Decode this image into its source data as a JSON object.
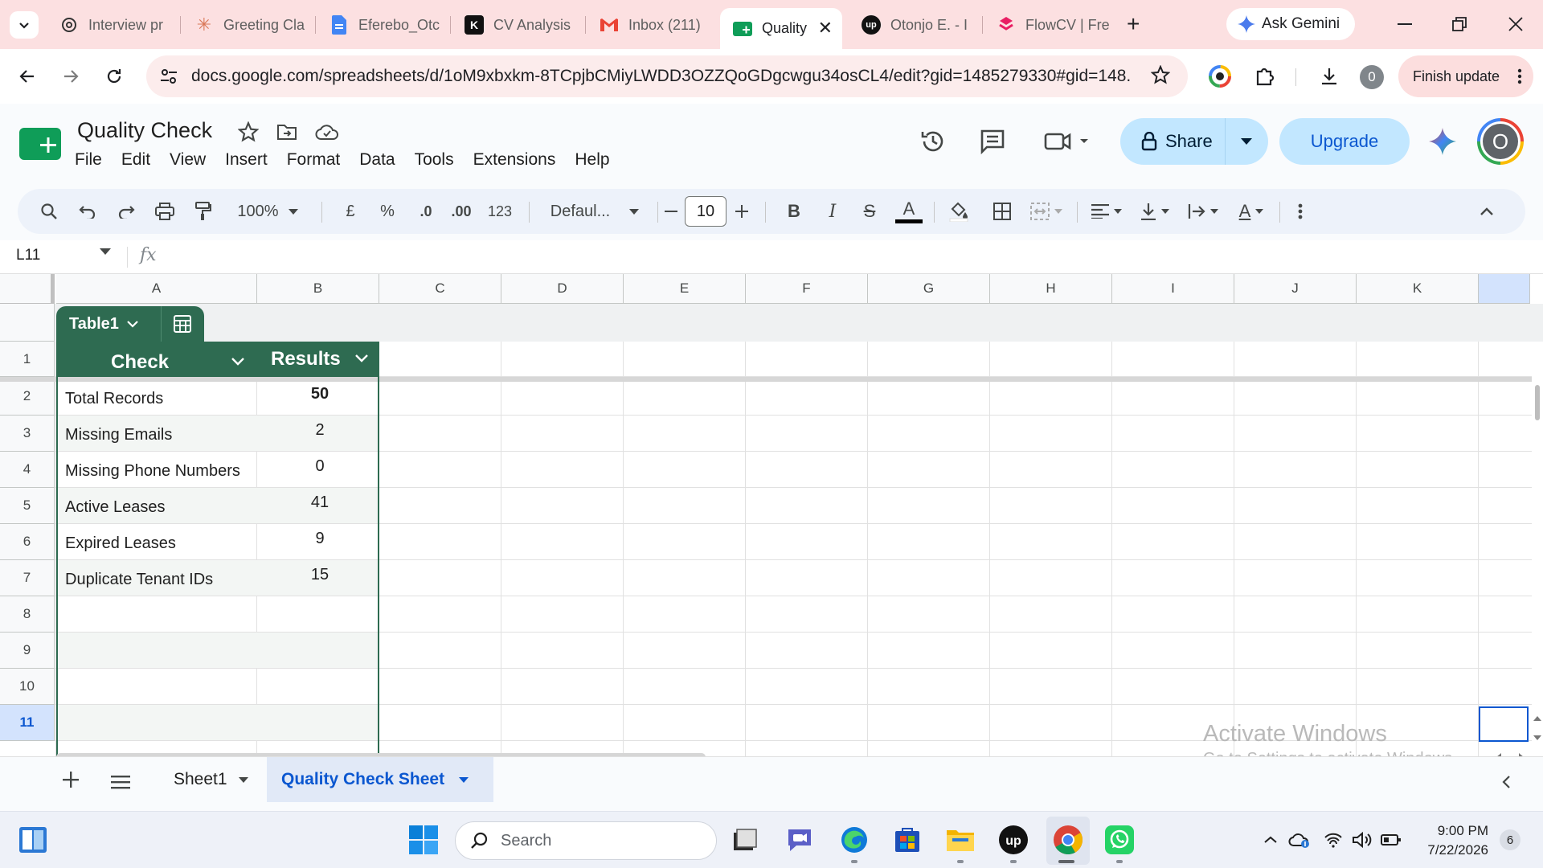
{
  "browser": {
    "tabs": [
      {
        "label": "Interview pr",
        "icon": "openai-icon"
      },
      {
        "label": "Greeting Cla",
        "icon": "claude-icon"
      },
      {
        "label": "Eferebo_Otc",
        "icon": "google-docs-icon"
      },
      {
        "label": "CV Analysis",
        "icon": "k-logo-icon"
      },
      {
        "label": "Inbox (211)",
        "icon": "gmail-icon"
      },
      {
        "label": "Quality",
        "icon": "google-sheets-icon",
        "active": true
      },
      {
        "label": "Otonjo E. - I",
        "icon": "upwork-icon"
      },
      {
        "label": "FlowCV | Fre",
        "icon": "flowcv-icon"
      }
    ],
    "ask_gemini": "Ask Gemini",
    "url": "docs.google.com/spreadsheets/d/1oM9xbxkm-8TCpjbCMiyLWDD3OZZQoGDgcwgu34osCL4/edit?gid=1485279330#gid=148...",
    "profile_initial": "0",
    "finish_update": "Finish update"
  },
  "sheets": {
    "title": "Quality Check",
    "menu": [
      "File",
      "Edit",
      "View",
      "Insert",
      "Format",
      "Data",
      "Tools",
      "Extensions",
      "Help"
    ],
    "share_label": "Share",
    "upgrade_label": "Upgrade",
    "avatar_initial": "O",
    "accent": "#2e6b51",
    "toolbar": {
      "zoom": "100%",
      "currency": "£",
      "percent": "%",
      "dec_decrease": ".0",
      "dec_increase": ".00",
      "number_format": "123",
      "font": "Defaul...",
      "font_size": "10",
      "bold": "B",
      "italic": "I",
      "strike": "S",
      "text_color": "A",
      "text_rotate": "A"
    },
    "name_box": "L11",
    "fx": "fx",
    "columns": [
      "A",
      "B",
      "C",
      "D",
      "E",
      "F",
      "G",
      "H",
      "I",
      "J",
      "K"
    ],
    "rows": [
      "1",
      "2",
      "3",
      "4",
      "5",
      "6",
      "7",
      "8",
      "9",
      "10",
      "11"
    ],
    "table": {
      "name": "Table1",
      "headers": [
        "Check",
        "Results"
      ],
      "rows": [
        {
          "check": "Total Records",
          "result": "50"
        },
        {
          "check": "Missing Emails",
          "result": "2"
        },
        {
          "check": "Missing Phone Numbers",
          "result": "0"
        },
        {
          "check": "Active Leases",
          "result": "41"
        },
        {
          "check": "Expired Leases",
          "result": "9"
        },
        {
          "check": "Duplicate Tenant IDs",
          "result": "15"
        }
      ]
    },
    "watermark": {
      "line1": "Activate Windows",
      "line2": "Go to Settings to activate Windows."
    },
    "sheet_tabs": [
      {
        "label": "Sheet1",
        "active": false
      },
      {
        "label": "Quality Check Sheet",
        "active": true
      }
    ]
  },
  "taskbar": {
    "search_placeholder": "Search",
    "time": "9:00 PM",
    "date": "7/22/2026",
    "notifications": "6"
  }
}
